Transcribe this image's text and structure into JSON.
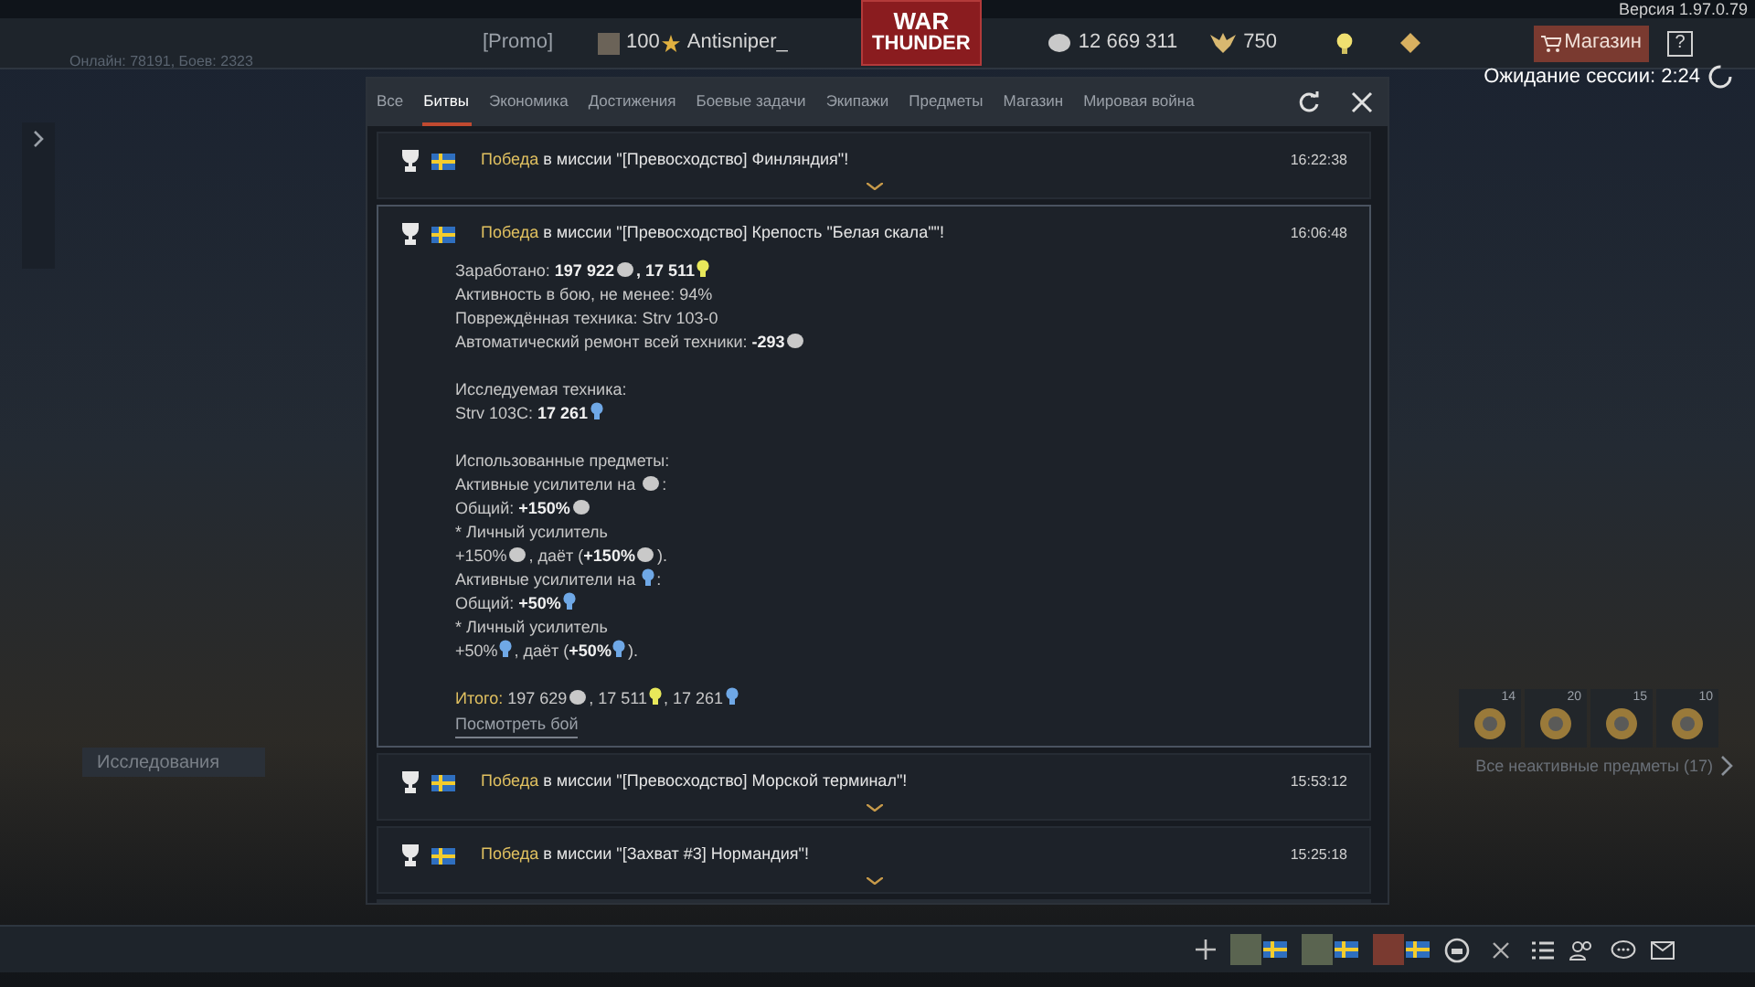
{
  "version": "Версия 1.97.0.79",
  "top_bar": {
    "promo": "[Promo]",
    "player_level": "100",
    "player_name": "Antisniper_",
    "logo_top": "WAR",
    "logo_bottom": "THUNDER",
    "silver": "12 669 311",
    "gold": "750",
    "shop": "Магазин",
    "help": "?"
  },
  "online": "Онлайн: 78191, Боев: 2323",
  "session": "Ожидание сессии: 2:24",
  "tabs": [
    {
      "label": "Все",
      "selected": false
    },
    {
      "label": "Битвы",
      "selected": true
    },
    {
      "label": "Экономика",
      "selected": false
    },
    {
      "label": "Достижения",
      "selected": false
    },
    {
      "label": "Боевые задачи",
      "selected": false
    },
    {
      "label": "Экипажи",
      "selected": false
    },
    {
      "label": "Предметы",
      "selected": false
    },
    {
      "label": "Магазин",
      "selected": false
    },
    {
      "label": "Мировая война",
      "selected": false
    }
  ],
  "messages": [
    {
      "result": "Победа",
      "text": "в миссии \"[Превосходство] Финляндия\"!",
      "time": "16:22:38",
      "expanded": false
    },
    {
      "result": "Победа",
      "text": "в миссии \"[Превосходство] Крепость \"Белая скала\"\"!",
      "time": "16:06:48",
      "expanded": true,
      "details": [
        {
          "gap_before": false,
          "parts": [
            {
              "kind": "text",
              "text": "Заработано: "
            },
            {
              "kind": "bold",
              "text": "197 922"
            },
            {
              "kind": "silver"
            },
            {
              "kind": "bold",
              "text": ", 17 511"
            },
            {
              "kind": "rp"
            }
          ]
        },
        {
          "gap_before": false,
          "parts": [
            {
              "kind": "text",
              "text": "Активность в бою, не менее: 94%"
            }
          ]
        },
        {
          "gap_before": false,
          "parts": [
            {
              "kind": "text",
              "text": "Повреждённая техника: Strv 103-0"
            }
          ]
        },
        {
          "gap_before": false,
          "parts": [
            {
              "kind": "text",
              "text": "Автоматический ремонт всей техники: "
            },
            {
              "kind": "bold",
              "text": "-293"
            },
            {
              "kind": "silver"
            }
          ]
        },
        {
          "gap_before": true,
          "parts": [
            {
              "kind": "text",
              "text": "Исследуемая техника:"
            }
          ]
        },
        {
          "gap_before": false,
          "parts": [
            {
              "kind": "text",
              "text": "Strv 103C: "
            },
            {
              "kind": "bold",
              "text": "17 261"
            },
            {
              "kind": "research"
            }
          ]
        },
        {
          "gap_before": true,
          "parts": [
            {
              "kind": "text",
              "text": "Использованные предметы:"
            }
          ]
        },
        {
          "gap_before": false,
          "parts": [
            {
              "kind": "text",
              "text": "Активные усилители на "
            },
            {
              "kind": "silver"
            },
            {
              "kind": "text",
              "text": ":"
            }
          ]
        },
        {
          "gap_before": false,
          "parts": [
            {
              "kind": "text",
              "text": "Общий: "
            },
            {
              "kind": "bold",
              "text": "+150%"
            },
            {
              "kind": "silver"
            }
          ]
        },
        {
          "gap_before": false,
          "parts": [
            {
              "kind": "text",
              "text": "* Личный усилитель"
            }
          ]
        },
        {
          "gap_before": false,
          "parts": [
            {
              "kind": "text",
              "text": "+150%"
            },
            {
              "kind": "silver"
            },
            {
              "kind": "text",
              "text": ", даёт ("
            },
            {
              "kind": "bold",
              "text": "+150%"
            },
            {
              "kind": "silver"
            },
            {
              "kind": "text",
              "text": ")."
            }
          ]
        },
        {
          "gap_before": false,
          "parts": [
            {
              "kind": "text",
              "text": "Активные усилители на "
            },
            {
              "kind": "research"
            },
            {
              "kind": "text",
              "text": ":"
            }
          ]
        },
        {
          "gap_before": false,
          "parts": [
            {
              "kind": "text",
              "text": "Общий: "
            },
            {
              "kind": "bold",
              "text": "+50%"
            },
            {
              "kind": "research"
            }
          ]
        },
        {
          "gap_before": false,
          "parts": [
            {
              "kind": "text",
              "text": "* Личный усилитель"
            }
          ]
        },
        {
          "gap_before": false,
          "parts": [
            {
              "kind": "text",
              "text": "+50%"
            },
            {
              "kind": "research"
            },
            {
              "kind": "text",
              "text": ", даёт ("
            },
            {
              "kind": "bold",
              "text": "+50%"
            },
            {
              "kind": "research"
            },
            {
              "kind": "text",
              "text": ")."
            }
          ]
        },
        {
          "gap_before": true,
          "parts": [
            {
              "kind": "total",
              "text": "Итого: "
            },
            {
              "kind": "text",
              "text": "197 629"
            },
            {
              "kind": "silver"
            },
            {
              "kind": "text",
              "text": ", 17 511"
            },
            {
              "kind": "rp"
            },
            {
              "kind": "text",
              "text": ", 17 261"
            },
            {
              "kind": "research"
            }
          ]
        }
      ],
      "link": "Посмотреть бой"
    },
    {
      "result": "Победа",
      "text": "в миссии \"[Превосходство] Морской терминал\"!",
      "time": "15:53:12",
      "expanded": false
    },
    {
      "result": "Победа",
      "text": "в миссии \"[Захват #3] Нормандия\"!",
      "time": "15:25:18",
      "expanded": false
    }
  ],
  "research_label": "Исследования",
  "boosters": [
    {
      "count": "14"
    },
    {
      "count": "20"
    },
    {
      "count": "15"
    },
    {
      "count": "10"
    }
  ],
  "inactive_items": "Все неактивные предметы (17)"
}
